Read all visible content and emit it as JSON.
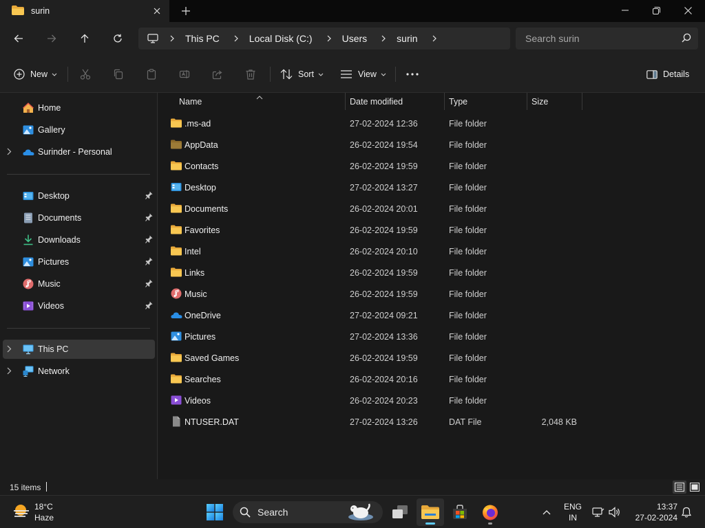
{
  "window": {
    "tab_title": "surin",
    "controls": [
      "minimize",
      "maximize",
      "close"
    ]
  },
  "address": {
    "breadcrumbs": [
      "This PC",
      "Local Disk (C:)",
      "Users",
      "surin"
    ],
    "search_placeholder": "Search surin"
  },
  "toolbar": {
    "new_label": "New",
    "sort_label": "Sort",
    "view_label": "View",
    "more_label": "...",
    "details_label": "Details"
  },
  "sidebar": {
    "top": [
      {
        "label": "Home",
        "icon": "home-icon"
      },
      {
        "label": "Gallery",
        "icon": "gallery-icon"
      },
      {
        "label": "Surinder - Personal",
        "icon": "onedrive-icon"
      }
    ],
    "quick_access": [
      {
        "label": "Desktop",
        "icon": "desktop-folder-icon"
      },
      {
        "label": "Documents",
        "icon": "documents-folder-icon"
      },
      {
        "label": "Downloads",
        "icon": "downloads-folder-icon"
      },
      {
        "label": "Pictures",
        "icon": "pictures-folder-icon"
      },
      {
        "label": "Music",
        "icon": "music-folder-icon"
      },
      {
        "label": "Videos",
        "icon": "videos-folder-icon"
      }
    ],
    "drives": [
      {
        "label": "This PC",
        "icon": "this-pc-icon",
        "selected": true
      },
      {
        "label": "Network",
        "icon": "network-icon"
      }
    ]
  },
  "columns": {
    "name": "Name",
    "date": "Date modified",
    "type": "Type",
    "size": "Size"
  },
  "files": [
    {
      "name": ".ms-ad",
      "date": "27-02-2024 12:36",
      "type": "File folder",
      "size": "",
      "icon": "folder"
    },
    {
      "name": "AppData",
      "date": "26-02-2024 19:54",
      "type": "File folder",
      "size": "",
      "icon": "folder-hidden"
    },
    {
      "name": "Contacts",
      "date": "26-02-2024 19:59",
      "type": "File folder",
      "size": "",
      "icon": "folder"
    },
    {
      "name": "Desktop",
      "date": "27-02-2024 13:27",
      "type": "File folder",
      "size": "",
      "icon": "desktop"
    },
    {
      "name": "Documents",
      "date": "26-02-2024 20:01",
      "type": "File folder",
      "size": "",
      "icon": "folder"
    },
    {
      "name": "Favorites",
      "date": "26-02-2024 19:59",
      "type": "File folder",
      "size": "",
      "icon": "folder"
    },
    {
      "name": "Intel",
      "date": "26-02-2024 20:10",
      "type": "File folder",
      "size": "",
      "icon": "folder"
    },
    {
      "name": "Links",
      "date": "26-02-2024 19:59",
      "type": "File folder",
      "size": "",
      "icon": "folder"
    },
    {
      "name": "Music",
      "date": "26-02-2024 19:59",
      "type": "File folder",
      "size": "",
      "icon": "music"
    },
    {
      "name": "OneDrive",
      "date": "27-02-2024 09:21",
      "type": "File folder",
      "size": "",
      "icon": "onedrive"
    },
    {
      "name": "Pictures",
      "date": "27-02-2024 13:36",
      "type": "File folder",
      "size": "",
      "icon": "pictures"
    },
    {
      "name": "Saved Games",
      "date": "26-02-2024 19:59",
      "type": "File folder",
      "size": "",
      "icon": "folder"
    },
    {
      "name": "Searches",
      "date": "26-02-2024 20:16",
      "type": "File folder",
      "size": "",
      "icon": "folder"
    },
    {
      "name": "Videos",
      "date": "26-02-2024 20:23",
      "type": "File folder",
      "size": "",
      "icon": "videos"
    },
    {
      "name": "NTUSER.DAT",
      "date": "27-02-2024 13:26",
      "type": "DAT File",
      "size": "2,048 KB",
      "icon": "file"
    }
  ],
  "status": {
    "item_count": "15 items"
  },
  "taskbar": {
    "weather_temp": "18°C",
    "weather_cond": "Haze",
    "search_label": "Search",
    "lang_top": "ENG",
    "lang_bottom": "IN",
    "time": "13:37",
    "date": "27-02-2024"
  },
  "colors": {
    "folder_yellow": "#f5c042",
    "accent": "#60cdff",
    "selected_bg": "#383838"
  }
}
